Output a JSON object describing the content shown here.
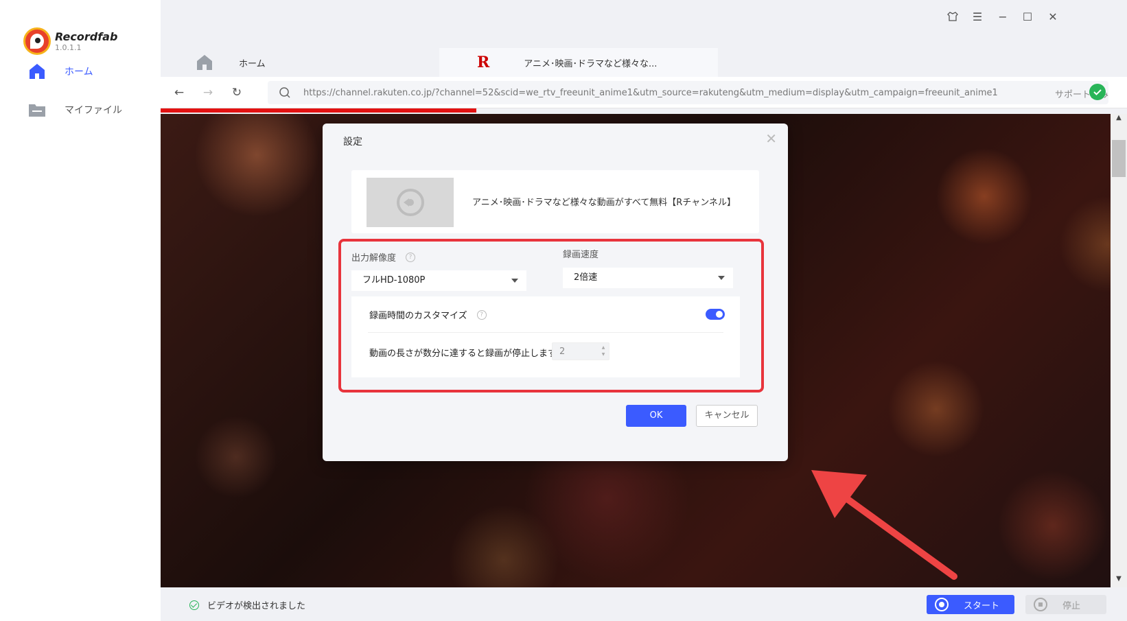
{
  "app": {
    "name": "Recordfab",
    "version": "1.0.1.1"
  },
  "sidebar": {
    "items": [
      {
        "label": "ホーム",
        "icon": "home-icon",
        "active": true
      },
      {
        "label": "マイファイル",
        "icon": "folder-icon",
        "active": false
      }
    ]
  },
  "tabs": [
    {
      "label": "ホーム",
      "icon": "home-icon"
    },
    {
      "label": "アニメ･映画･ドラマなど様々な...",
      "icon": "rakuten-r-icon",
      "logo_text": "R"
    }
  ],
  "addressbar": {
    "url": "https://channel.rakuten.co.jp/?channel=52&scid=we_rtv_freeunit_anime1&utm_source=rakuteng&utm_medium=display&utm_campaign=freeunit_anime1",
    "status": "サポート済み"
  },
  "dialog": {
    "title": "設定",
    "video_title": "アニメ･映画･ドラマなど様々な動画がすべて無料【Rチャンネル】",
    "resolution_label": "出力解像度",
    "resolution_value": "フルHD-1080P",
    "speed_label": "録画速度",
    "speed_value": "2倍速",
    "custom_time_label": "録画時間のカスタマイズ",
    "custom_time_enabled": true,
    "duration_label": "動画の長さが数分に達すると録画が停止します",
    "duration_value": "2",
    "ok_label": "OK",
    "cancel_label": "キャンセル"
  },
  "status": {
    "detected_text": "ビデオが検出されました",
    "start_label": "スタート",
    "stop_label": "停止"
  },
  "colors": {
    "accent": "#3b5bff",
    "highlight": "#e8343c",
    "progress": "#e31212",
    "success": "#28b458"
  }
}
